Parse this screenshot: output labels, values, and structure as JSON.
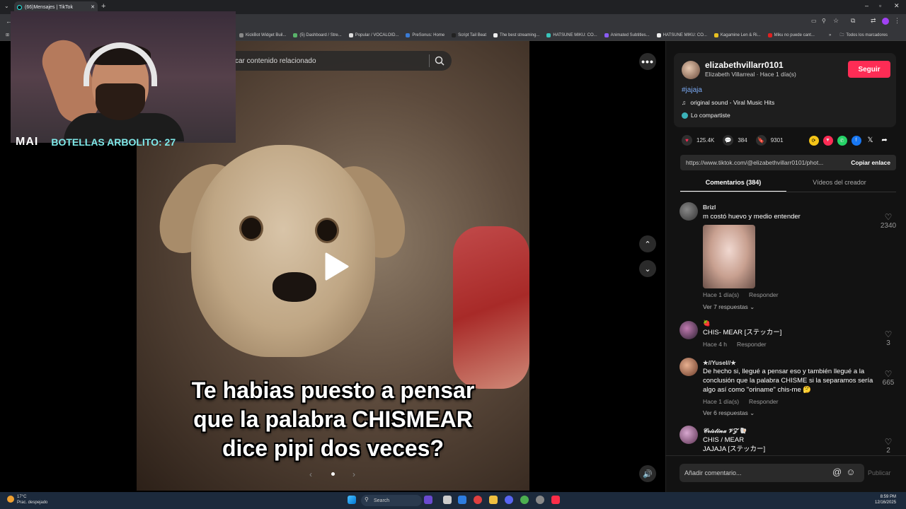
{
  "browser": {
    "tab_title": "(66)Mensajes | TikTok",
    "new_tab": "+",
    "bookmarks": [
      "KickBot Widget Buil...",
      "(5) Dashboard / Stre...",
      "Popular / VOCALOID...",
      "PreSonus: Home",
      "Script Tail Beat",
      "The best streaming...",
      "HATSUNE MIKU: CO...",
      "Animated Subtitles...",
      "HATSUNE MIKU: CO...",
      "Kagamine Len & Ri...",
      "Miku no puede cant..."
    ],
    "bookmarks_more": "»",
    "all_bookmarks": "Todos los marcadores"
  },
  "overlay": {
    "logo": "MAI",
    "counter": "BOTELLAS ARBOLITO: 27"
  },
  "search": {
    "placeholder": "car contenido relacionado"
  },
  "video": {
    "caption_line1": "Te habias puesto a pensar",
    "caption_line2": "que la palabra CHISMEAR",
    "caption_line3": "dice pipi dos veces?"
  },
  "author": {
    "username": "elizabethvillarr0101",
    "meta": "Elizabeth Villarreal · Hace 1 día(s)",
    "follow_label": "Seguir",
    "hashtag": "#jajaja",
    "sound": "original sound - Viral Music Hits",
    "shared": "Lo compartiste"
  },
  "stats": {
    "likes": "125.4K",
    "comments": "384",
    "saves": "9301"
  },
  "link": {
    "url": "https://www.tiktok.com/@elizabethvillarr0101/phot...",
    "copy_label": "Copiar enlace"
  },
  "tabs": {
    "comments": "Comentarios (384)",
    "creator_videos": "Vídeos del creador"
  },
  "comments": [
    {
      "user": "Brizl",
      "text": "m costó huevo y medio entender",
      "time": "Hace 1 día(s)",
      "reply": "Responder",
      "replies": "Ver 7 respuestas",
      "likes": "2340"
    },
    {
      "user": "🍓",
      "text": "CHIS- MEAR [ステッカー]",
      "time": "Hace 4 h",
      "reply": "Responder",
      "likes": "3"
    },
    {
      "user": "★//Yusel//★",
      "text": "De hecho si, llegué a pensar eso y también llegué a la conclusión que la palabra CHISME si la separamos sería algo así como \"oriname\" chis-me 🤔",
      "time": "Hace 1 día(s)",
      "reply": "Responder",
      "replies": "Ver 6 respuestas",
      "likes": "665"
    },
    {
      "user": "𝓒𝓻𝓲𝓼𝓽𝓲𝓷𝓪 𝓥𝓩 🐚",
      "text_line1": "CHIS / MEAR",
      "text_line2": "JAJAJA [ステッカー]",
      "likes": "2"
    }
  ],
  "comment_input": {
    "placeholder": "Añadir comentario...",
    "publish_label": "Publicar"
  },
  "taskbar": {
    "temperature": "17°C",
    "weather": "Prac. despejado",
    "search_label": "Search",
    "time": "8:59 PM",
    "date": "12/16/2025"
  },
  "colors": {
    "accent": "#fe2c55",
    "hashtag": "#7aaaf5",
    "overlay_counter": "#7fe9e9"
  }
}
